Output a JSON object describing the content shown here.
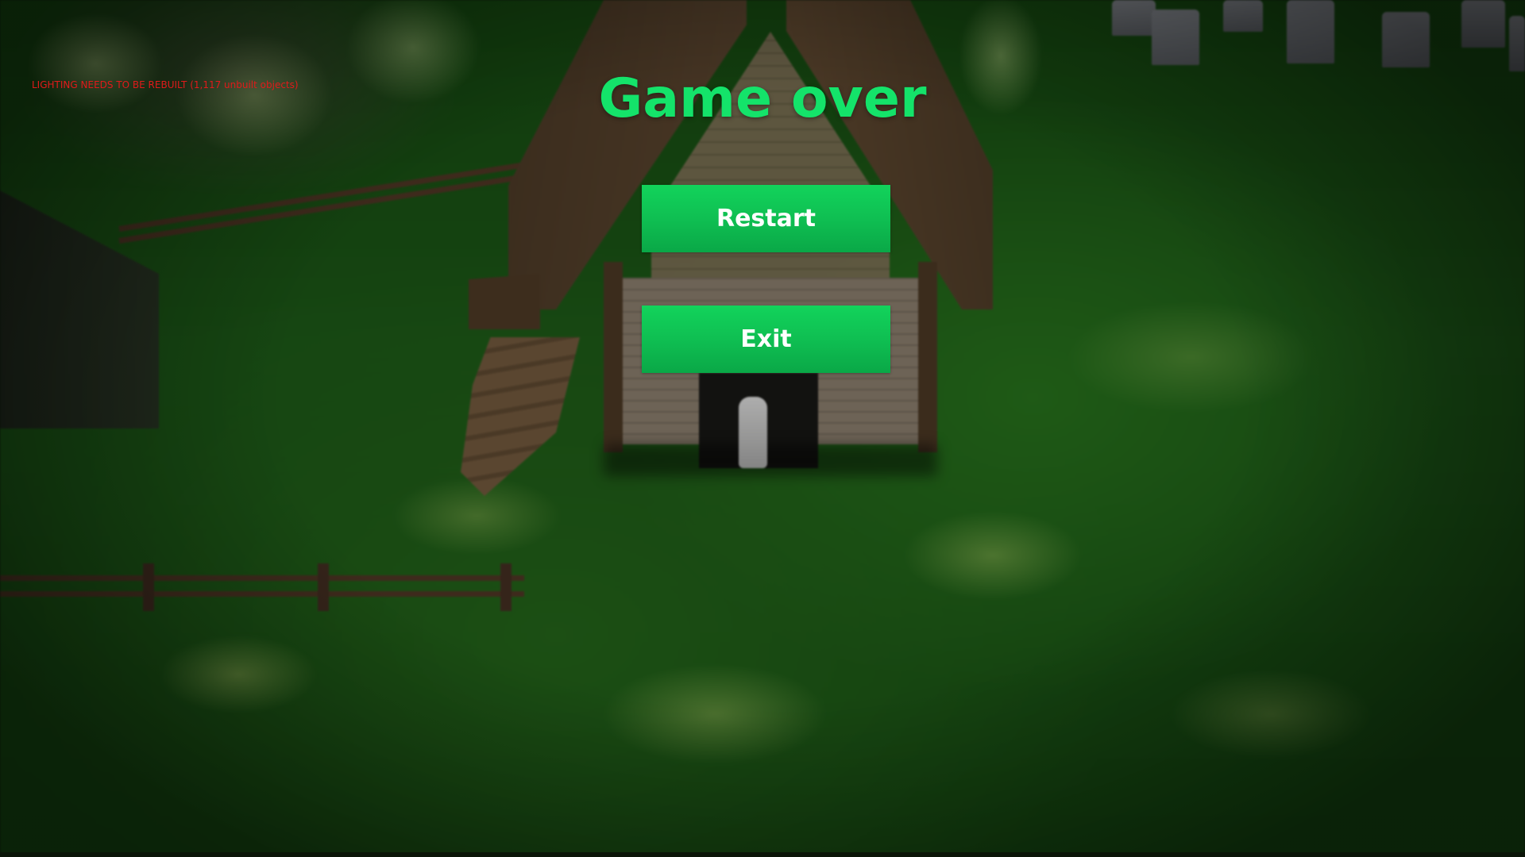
{
  "warning": {
    "text": "LIGHTING NEEDS TO BE REBUILT (1,117 unbuilt objects)",
    "color": "#e01a1a"
  },
  "menu": {
    "title": "Game over",
    "title_color": "#14e36a",
    "buttons": {
      "restart": "Restart",
      "exit": "Exit"
    },
    "button_color": "#0fbf52"
  }
}
